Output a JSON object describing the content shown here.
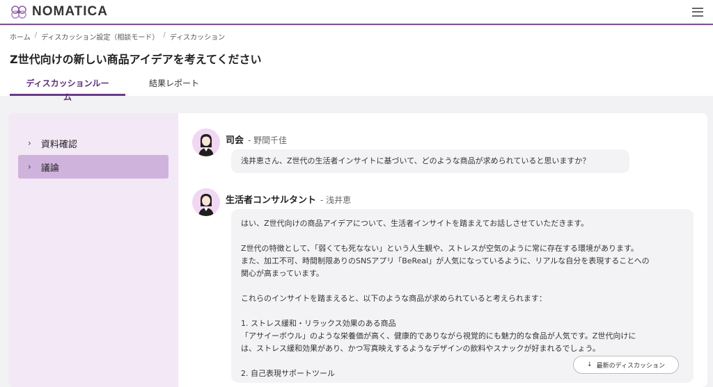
{
  "app": {
    "name": "NOMATICA"
  },
  "breadcrumb": [
    "ホーム",
    "ディスカッション設定（相談モード）",
    "ディスカッション"
  ],
  "page": {
    "title": "Z世代向けの新しい商品アイデアを考えてください"
  },
  "tabs": [
    {
      "label": "ディスカッションルーム",
      "active": true
    },
    {
      "label": "結果レポート",
      "active": false
    }
  ],
  "sidebar": {
    "items": [
      {
        "label": "資料確認",
        "active": false
      },
      {
        "label": "議論",
        "active": true
      }
    ]
  },
  "messages": [
    {
      "role": "司会",
      "person": "- 野間千佳",
      "paragraphs": [
        "浅井恵さん、Z世代の生活者インサイトに基づいて、どのような商品が求められていると思いますか？"
      ]
    },
    {
      "role": "生活者コンサルタント",
      "person": "- 浅井恵",
      "paragraphs": [
        "はい、Z世代向けの商品アイデアについて、生活者インサイトを踏まえてお話しさせていただきます。",
        "Z世代の特徴として、「弱くても死なない」という人生観や、ストレスが空気のように常に存在する環境があります。",
        "また、加工不可、時間制限ありのSNSアプリ「BeReal」が人気になっているように、リアルな自分を表現することへの",
        "関心が高まっています。",
        "これらのインサイトを踏まえると、以下のような商品が求められていると考えられます：",
        "1. ストレス緩和・リラックス効果のある商品",
        "「アサイーボウル」のような栄養価が高く、健康的でありながら視覚的にも魅力的な食品が人気です。Z世代向けに",
        "は、ストレス緩和効果があり、かつ写真映えするようなデザインの飲料やスナックが好まれるでしょう。",
        "2. 自己表現サポートツール"
      ]
    }
  ],
  "scroll_button": {
    "label": "最新のディスカッション"
  },
  "colors": {
    "accent": "#7b4f8e",
    "sidebar_bg": "#f3e8f6",
    "sidebar_active": "#cfb3dc"
  }
}
